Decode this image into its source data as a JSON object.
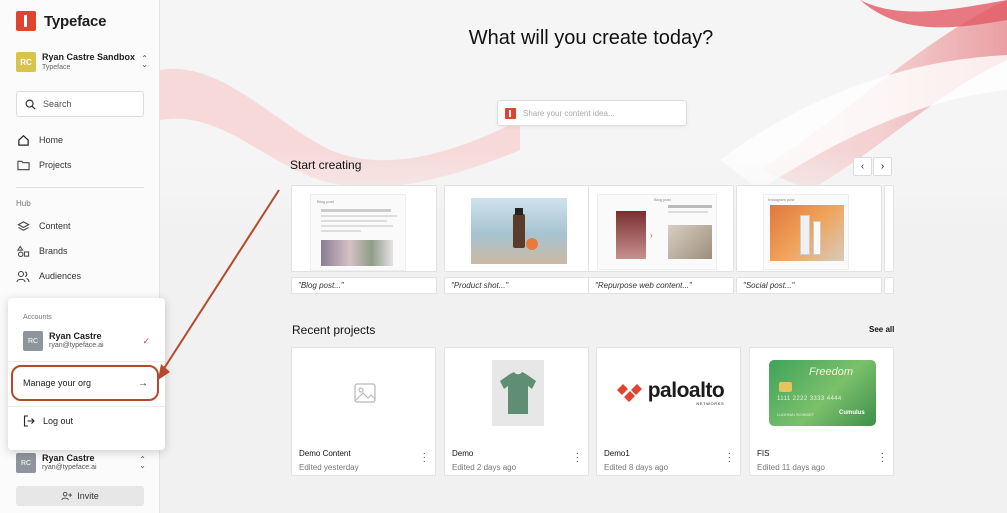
{
  "app": {
    "brand": "Typeface"
  },
  "workspace": {
    "initials": "RC",
    "name": "Ryan Castre Sandbox",
    "subtitle": "Typeface"
  },
  "search": {
    "placeholder": "Search"
  },
  "nav": {
    "home": "Home",
    "projects": "Projects",
    "section_hub": "Hub",
    "content": "Content",
    "brands": "Brands",
    "audiences": "Audiences"
  },
  "popover": {
    "accounts_label": "Accounts",
    "user": {
      "initials": "RC",
      "name": "Ryan Castre",
      "email": "ryan@typeface.ai"
    },
    "manage_org": "Manage your org",
    "logout": "Log out"
  },
  "sidebar_user": {
    "initials": "RC",
    "name": "Ryan Castre",
    "email": "ryan@typeface.ai"
  },
  "invite": {
    "label": "Invite"
  },
  "hero": {
    "title": "What will you create today?",
    "prompt_placeholder": "Share your content idea..."
  },
  "start_creating": {
    "title": "Start creating",
    "templates": [
      {
        "caption": "\"Blog post...\"",
        "tag": "Blog post"
      },
      {
        "caption": "\"Product shot...\"",
        "tag": ""
      },
      {
        "caption": "\"Repurpose web content...\"",
        "tag": "Blog post"
      },
      {
        "caption": "\"Social post...\"",
        "tag": "Instagram post"
      }
    ]
  },
  "recent": {
    "title": "Recent projects",
    "see_all": "See all",
    "projects": [
      {
        "name": "Demo Content",
        "edited": "Edited yesterday",
        "thumb": "image-placeholder-icon"
      },
      {
        "name": "Demo",
        "edited": "Edited 2 days ago",
        "thumb": "tshirt"
      },
      {
        "name": "Demo1",
        "edited": "Edited 8 days ago",
        "thumb": "paloalto-logo"
      },
      {
        "name": "FIS",
        "edited": "Edited 11 days ago",
        "thumb": "credit-card"
      }
    ],
    "paloalto": {
      "word": "paloalto",
      "sub": "NETWORKS"
    },
    "card": {
      "title": "Freedom",
      "number": "1111 2222 3333 4444",
      "holder": "LUGHNAI SCHMIDT",
      "issuer": "Cumulus"
    }
  },
  "colors": {
    "accent": "#e0442f",
    "annotation": "#b5492b"
  }
}
